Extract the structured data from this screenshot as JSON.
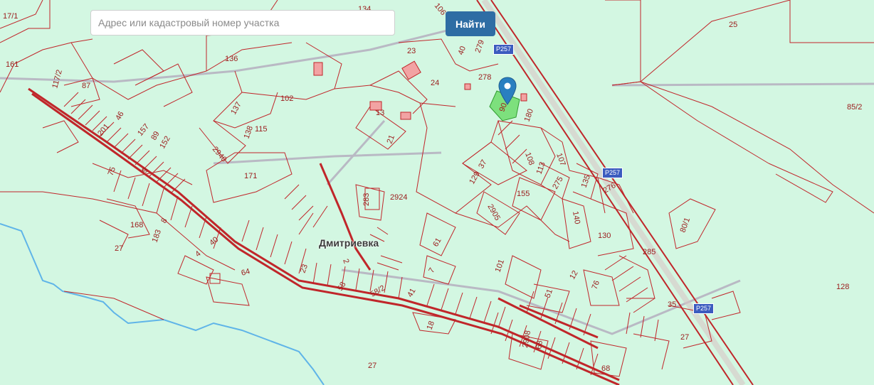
{
  "search": {
    "placeholder": "Адрес или кадастровый номер участка",
    "button_label": "Найти"
  },
  "map": {
    "village_label": "Дмитриевка",
    "road_badge": "Р257",
    "marker": "map-pin",
    "parcel_numbers": [
      "17/1",
      "134",
      "106",
      "25",
      "161",
      "117/2",
      "87",
      "136",
      "23",
      "40",
      "279",
      "278",
      "24",
      "102",
      "137",
      "13",
      "90",
      "180",
      "85/2",
      "201",
      "46",
      "157",
      "89",
      "152",
      "138",
      "115",
      "2940",
      "21",
      "108",
      "107",
      "113",
      "75",
      "9",
      "171",
      "37",
      "129",
      "275",
      "135",
      "276",
      "2924",
      "283",
      "155",
      "2905",
      "140",
      "80/1",
      "168",
      "8",
      "183",
      "130",
      "27",
      "4",
      "40",
      "2",
      "61",
      "285",
      "64",
      "23",
      "101",
      "7",
      "12",
      "76",
      "128",
      "58",
      "58/2",
      "41",
      "51",
      "35",
      "18",
      "2908",
      "68",
      "27"
    ],
    "colors": {
      "background": "#d3f7e2",
      "parcel_lines": "#c0262a",
      "selected_parcel": "#7de07d",
      "river": "#5fb4e8",
      "marker": "#2a7fc0",
      "button": "#2e6da4"
    }
  }
}
